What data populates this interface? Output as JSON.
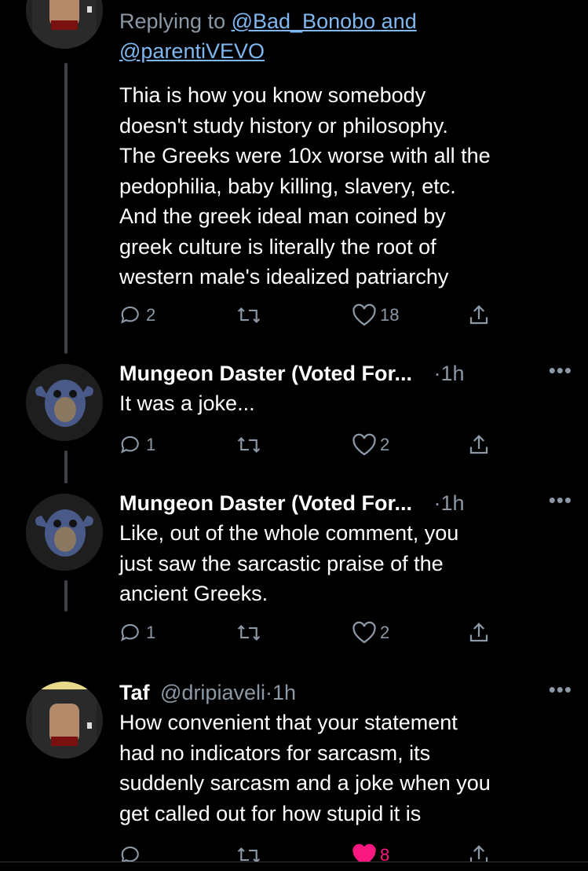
{
  "tweet1": {
    "reply_prefix": "Replying to ",
    "reply_handle1": "@Bad_Bonobo",
    "reply_and": " and",
    "reply_handle2": "@parentiVEVO",
    "body_lines": [
      "Thia is how you know somebody",
      "doesn't study history or philosophy.",
      "The Greeks were 10x worse with all the",
      "pedophilia, baby killing, slavery, etc.",
      "And the greek ideal man coined by",
      "greek culture is literally the root of",
      "western male's idealized patriarchy"
    ],
    "replies": "2",
    "retweets": "",
    "likes": "18"
  },
  "tweet2": {
    "name": "Mungeon Daster (Voted For...",
    "time": "·1h",
    "more": "•••",
    "body_lines": [
      "It was a joke..."
    ],
    "replies": "1",
    "likes": "2"
  },
  "tweet3": {
    "name": "Mungeon Daster (Voted For...",
    "time": "·1h",
    "more": "•••",
    "body_lines": [
      "Like, out of the whole comment, you",
      "just saw the sarcastic praise of the",
      "ancient Greeks."
    ],
    "replies": "1",
    "likes": "2"
  },
  "tweet4": {
    "name": "Taf",
    "handle": "@dripiaveli",
    "time": "·1h",
    "more": "•••",
    "body_lines": [
      "How convenient that your statement",
      "had no indicators for sarcasm, its",
      "suddenly sarcasm and a joke when you",
      "get called out for how stupid it is"
    ],
    "likes": "8"
  },
  "colors": {
    "muted": "#8b98a5",
    "link": "#7fb7f0",
    "like": "#f91880",
    "background": "#000000"
  }
}
